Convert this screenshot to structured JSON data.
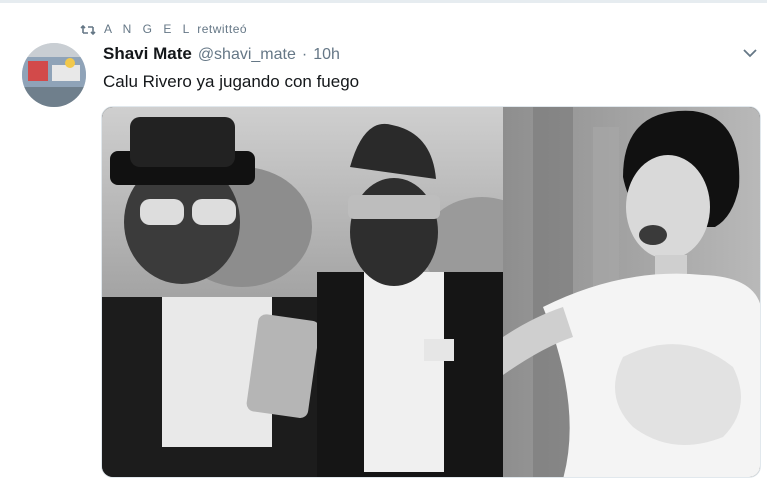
{
  "retweet": {
    "user": "A N G E L",
    "action": "retwitteó"
  },
  "tweet": {
    "display_name": "Shavi Mate",
    "handle": "@shavi_mate",
    "separator": "·",
    "time": "10h",
    "text": "Calu Rivero ya jugando con fuego"
  },
  "icons": {
    "retweet": "retweet-icon",
    "more": "chevron-down-icon"
  },
  "colors": {
    "secondary_text": "#657786",
    "primary_text": "#14171a",
    "retweet_green": "#657786"
  }
}
